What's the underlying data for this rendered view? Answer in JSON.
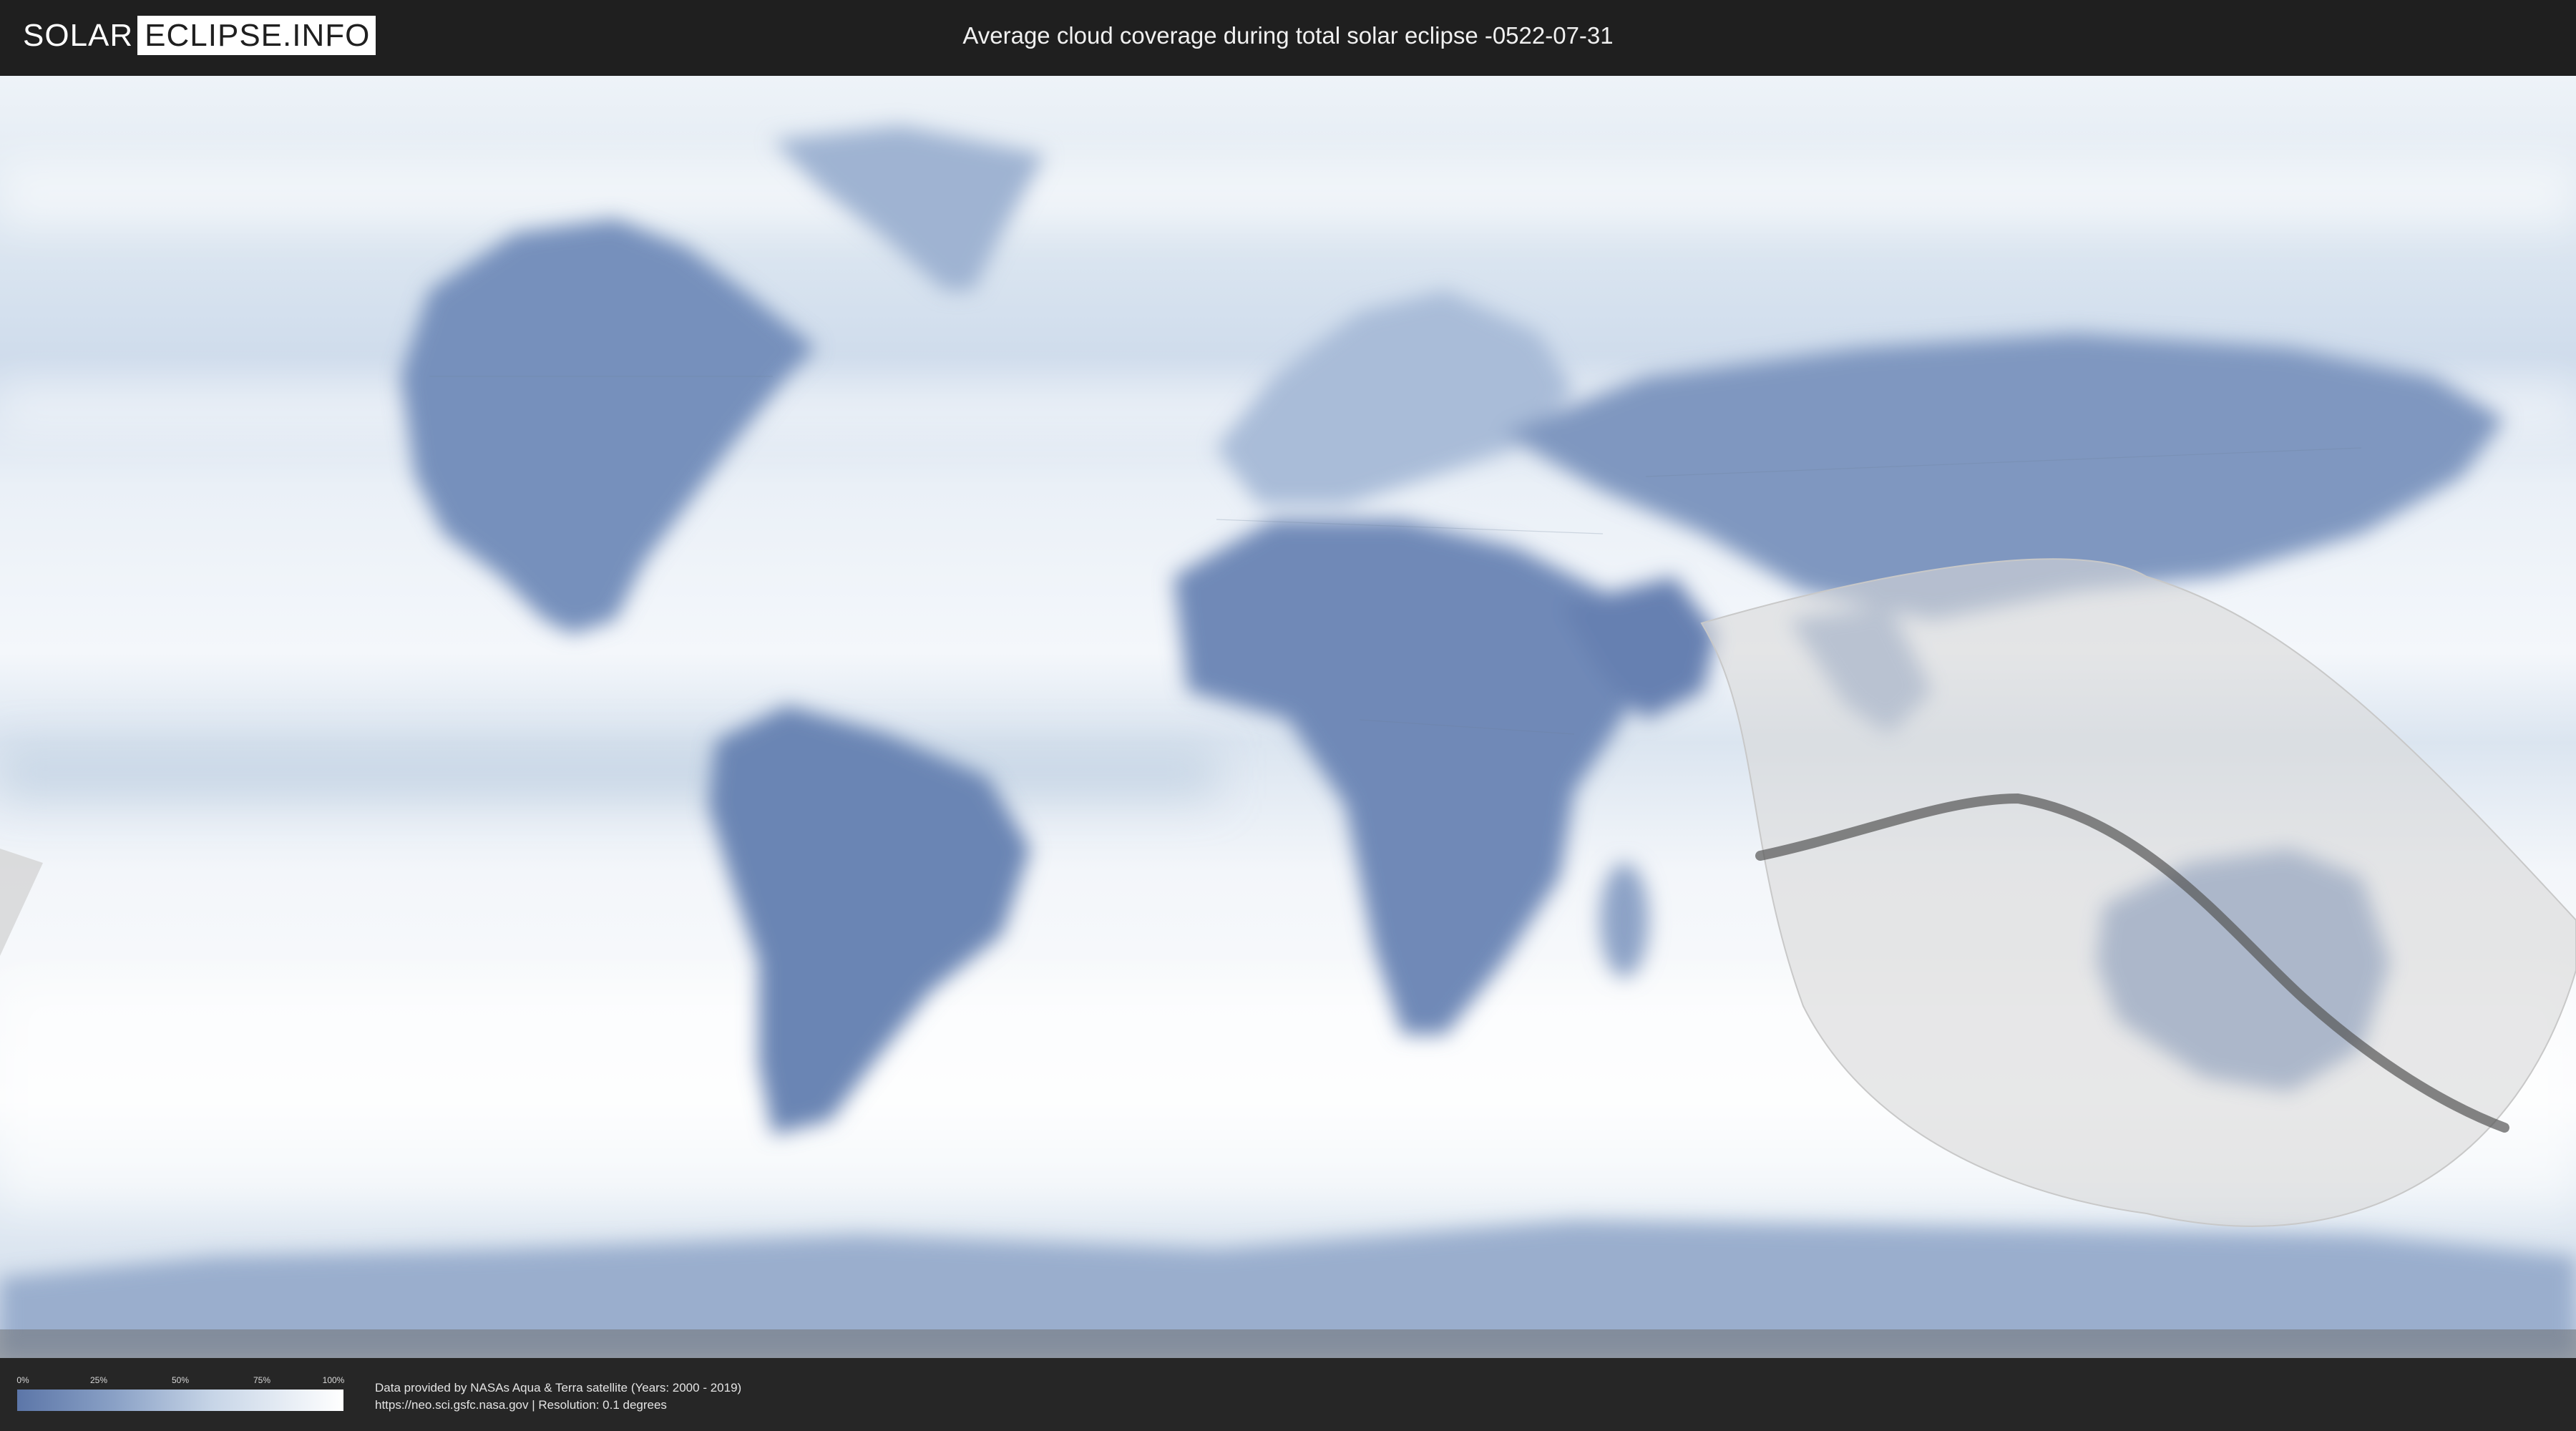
{
  "header": {
    "logo_left": "SOLAR",
    "logo_right": "ECLIPSE.INFO",
    "title": "Average cloud coverage during total solar eclipse -0522-07-31"
  },
  "map": {
    "projection": "equirectangular",
    "colors": {
      "clear": "#5c76a8",
      "cloudy": "#ffffff",
      "eclipse_zone": "#dcdcdc",
      "totality_path": "#555555"
    },
    "legend": {
      "ticks": [
        "0%",
        "25%",
        "50%",
        "75%",
        "100%"
      ],
      "tick_values": [
        0,
        25,
        50,
        75,
        100
      ]
    }
  },
  "footer": {
    "credit_line1": "Data provided by NASAs Aqua & Terra satellite (Years: 2000 - 2019)",
    "credit_line2": "https://neo.sci.gsfc.nasa.gov | Resolution: 0.1 degrees"
  }
}
